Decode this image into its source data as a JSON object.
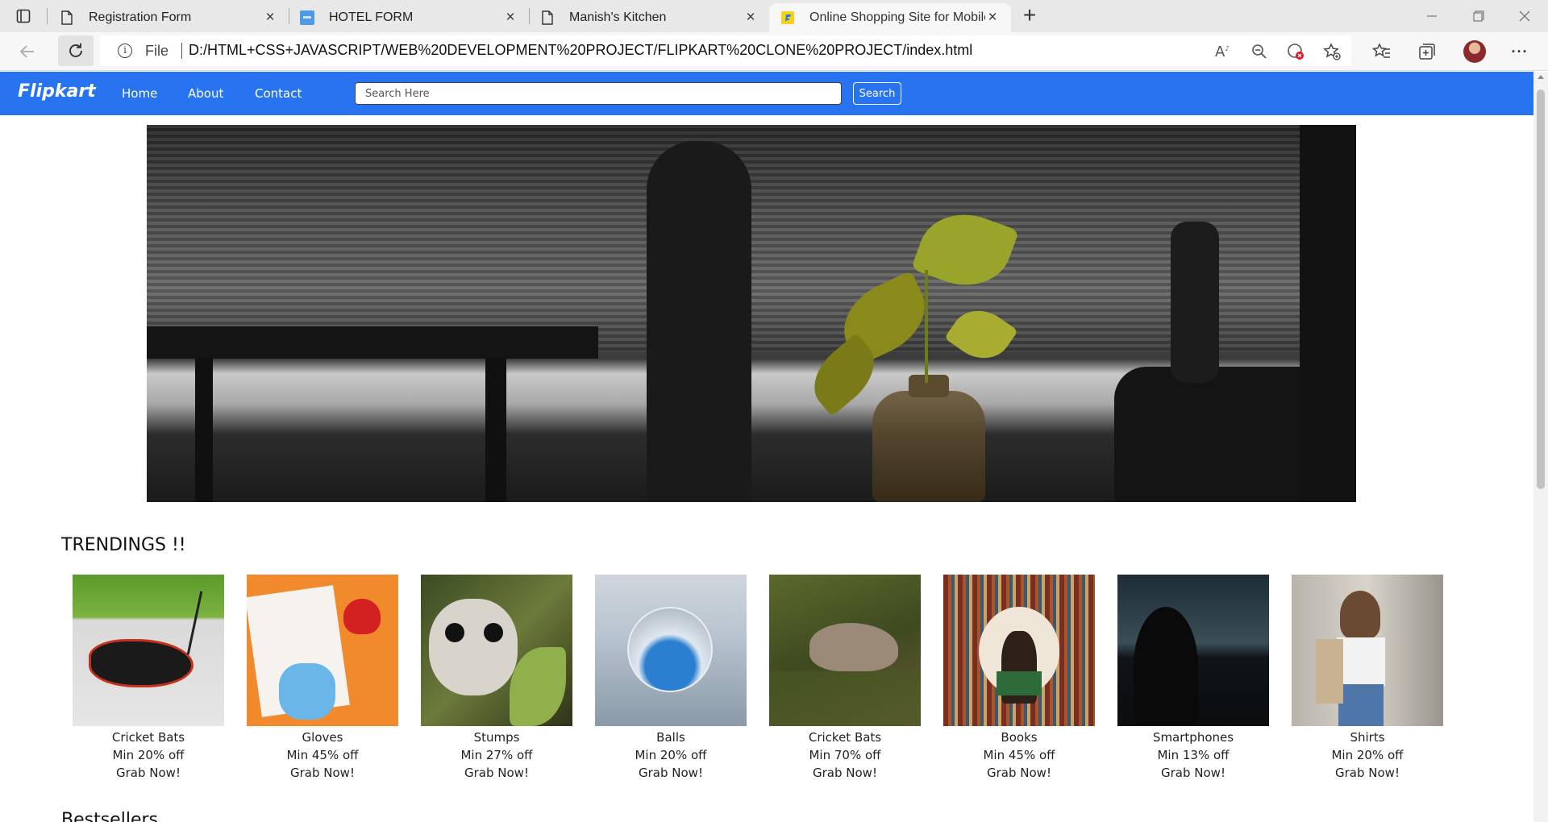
{
  "browser": {
    "tabs": [
      {
        "label": "Registration Form",
        "favicon": "page-icon"
      },
      {
        "label": "HOTEL FORM",
        "favicon": "hotel-favicon"
      },
      {
        "label": "Manish's Kitchen",
        "favicon": "page-icon"
      },
      {
        "label": "Online Shopping Site for Mobile",
        "favicon": "flipkart-favicon"
      }
    ],
    "address": {
      "scheme_label": "File",
      "url": "D:/HTML+CSS+JAVASCRIPT/WEB%20DEVELOPMENT%20PROJECT/FLIPKART%20CLONE%20PROJECT/index.html"
    }
  },
  "site": {
    "brand": "Flipkart",
    "nav": [
      "Home",
      "About",
      "Contact"
    ],
    "search_placeholder": "Search Here",
    "search_button": "Search"
  },
  "trendings": {
    "title": "TRENDINGS !!",
    "items": [
      {
        "name": "Cricket Bats",
        "offer": "Min 20% off",
        "cta": "Grab Now!",
        "image": "grasshopper-photo"
      },
      {
        "name": "Gloves",
        "offer": "Min 45% off",
        "cta": "Grab Now!",
        "image": "stethoscope-photo"
      },
      {
        "name": "Stumps",
        "offer": "Min 27% off",
        "cta": "Grab Now!",
        "image": "lemur-photo"
      },
      {
        "name": "Balls",
        "offer": "Min 20% off",
        "cta": "Grab Now!",
        "image": "glass-ball-photo"
      },
      {
        "name": "Cricket Bats",
        "offer": "Min 70% off",
        "cta": "Grab Now!",
        "image": "frog-photo"
      },
      {
        "name": "Books",
        "offer": "Min 45% off",
        "cta": "Grab Now!",
        "image": "library-photo"
      },
      {
        "name": "Smartphones",
        "offer": "Min 13% off",
        "cta": "Grab Now!",
        "image": "night-silhouette-photo"
      },
      {
        "name": "Shirts",
        "offer": "Min 20% off",
        "cta": "Grab Now!",
        "image": "woman-street-photo"
      }
    ]
  },
  "bestsellers": {
    "title": "Bestsellers"
  },
  "colors": {
    "brand_blue": "#2874f0",
    "tab_strip": "#e8e8e8"
  }
}
